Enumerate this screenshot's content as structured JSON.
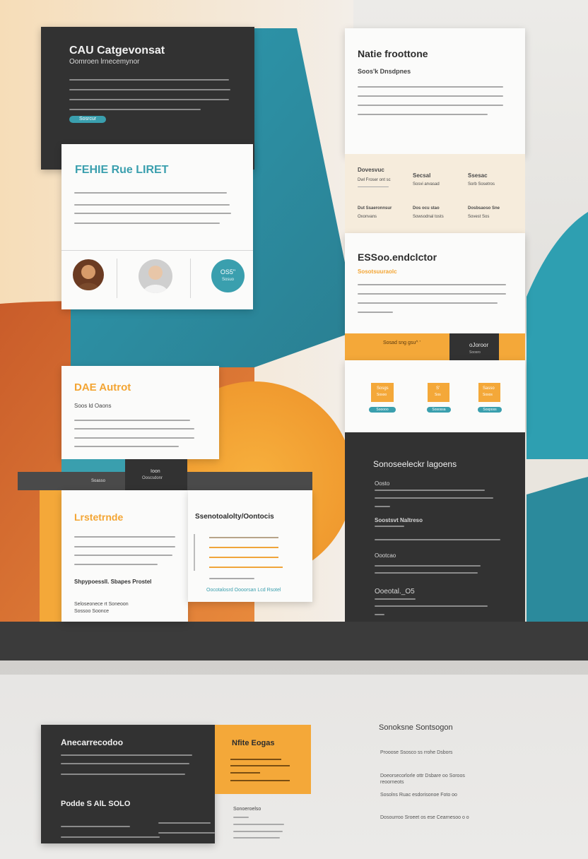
{
  "colors": {
    "teal": "#3a9fae",
    "orange": "#f4a839",
    "dark": "#323232",
    "cream": "#f6ecdc",
    "paper": "#fbfbfa"
  },
  "card1": {
    "title": "CAU Catgevonsat",
    "subtitle": "Oomroen lrnecemynor",
    "button": "Sosrcur"
  },
  "card2": {
    "title": "FEHIE Rue LIRET"
  },
  "people": {
    "bubble_line1": "OS5\"",
    "bubble_line2": "Sosuo"
  },
  "card3": {
    "title": "Natie froottone",
    "subtitle": "Soos'k Dnsdpnes"
  },
  "grid": {
    "cells": [
      {
        "head": "Dovesvuc",
        "body": "Dwl Froser ont sc"
      },
      {
        "head": "Secsal",
        "body": "Sosvi arvasad"
      },
      {
        "head": "Ssesac",
        "body": "Sorb Sosetros"
      },
      {
        "head": "Dut Ssaeronnsur",
        "body": "Oxonvans"
      },
      {
        "head": "Dos ocu stao",
        "body": "Sowsodnal tosts"
      },
      {
        "head": "Dosbsaoso Sne",
        "body": "Sovest Sos"
      }
    ]
  },
  "card4": {
    "title": "ESSoo.endclctor",
    "subtitle": "Sosotsuuraolc"
  },
  "bar": {
    "left": "Sosad sng gsu^ '",
    "right_top": "oJoroor",
    "right_bottom": "Soosro"
  },
  "tiles": [
    {
      "top": "Sosgs",
      "mid": "Sosoo",
      "btn": "Sooooo"
    },
    {
      "top": "S'",
      "mid": "Sos",
      "btn": "Sosossa"
    },
    {
      "top": "Sasso",
      "mid": "Sosos",
      "btn": "Sosposs"
    }
  ],
  "card5": {
    "title": "DAE Autrot",
    "subtitle": "Soos ld Oaons"
  },
  "midbar": {
    "left": "Soasso",
    "right_top": "Ioon",
    "right_bottom": "Ooscsdonr"
  },
  "card6": {
    "title": "Lrstetrnde",
    "bold": "Shpypoessll. Sbapes Prostel",
    "foot1": "Seloseonece rt Soneoon",
    "foot2": "Sossoo Soonce"
  },
  "card7": {
    "title": "Ssenotoalolty/Oontocis",
    "link": "Oocotalosrd Oooorsan Lcd Rsotel"
  },
  "dark_panel": {
    "title": "Sonoseeleckr lagoens",
    "sections": [
      {
        "head": "Oosto"
      },
      {
        "head": "Soostsvt Naltreso"
      },
      {
        "head": "Oootcao"
      },
      {
        "head": "Ooeotal._O5"
      }
    ]
  },
  "bottom_dark": {
    "title": "Anecarrecodoo",
    "bold": "Podde S AlL SOLO"
  },
  "bottom_orange": {
    "title": "Nfite Eogas"
  },
  "bottom_orange_foot": {
    "head": "Sonoeroelso"
  },
  "right_col": {
    "title": "Sonoksne Sontsogon",
    "items": [
      "Prooose Ssosco ss rrohe Dsbors",
      "Doeorsecorlorle ottr Dsbare oo Soroos reoorneots",
      "Sosolns Ruac esdorisonoe Foto oo",
      "Dosourroo Sroeet os ese Cearnesoo o o"
    ]
  }
}
